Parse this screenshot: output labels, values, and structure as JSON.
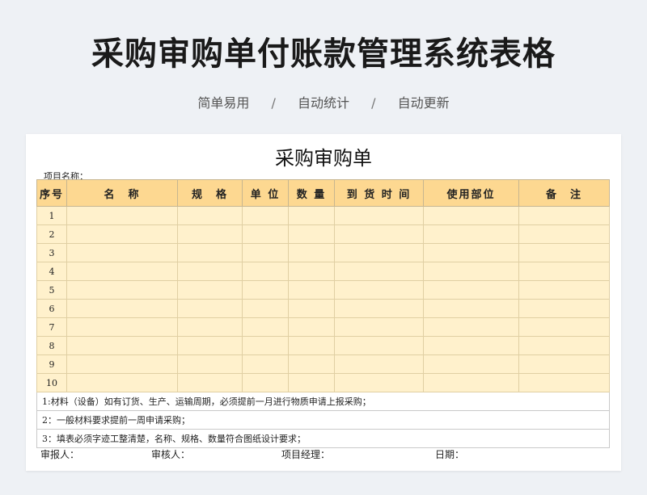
{
  "page": {
    "title": "采购审购单付账款管理系统表格",
    "features": [
      "简单易用",
      "自动统计",
      "自动更新"
    ],
    "separator": "/"
  },
  "sheet": {
    "title": "采购审购单",
    "project_label": "项目名称：",
    "headers": [
      "序号",
      "名　称",
      "规　格",
      "单 位",
      "数 量",
      "到 货 时 间",
      "使用部位",
      "备　注"
    ],
    "row_numbers": [
      "1",
      "2",
      "3",
      "4",
      "5",
      "6",
      "7",
      "8",
      "9",
      "10"
    ],
    "notes": [
      "1:材料（设备）如有订货、生产、运输周期，必须提前一月进行物质申请上报采购；",
      "2：一般材料要求提前一周申请采购；",
      "3：填表必须字迹工整清楚，名称、规格、数量符合图纸设计要求；"
    ],
    "signatures": {
      "reporter": "审报人：",
      "reviewer": "审核人：",
      "manager": "项目经理：",
      "date": "日期："
    }
  },
  "colors": {
    "header_bg": "#fdd891",
    "row_bg": "#fff1cc",
    "page_bg": "#eef1f5"
  }
}
